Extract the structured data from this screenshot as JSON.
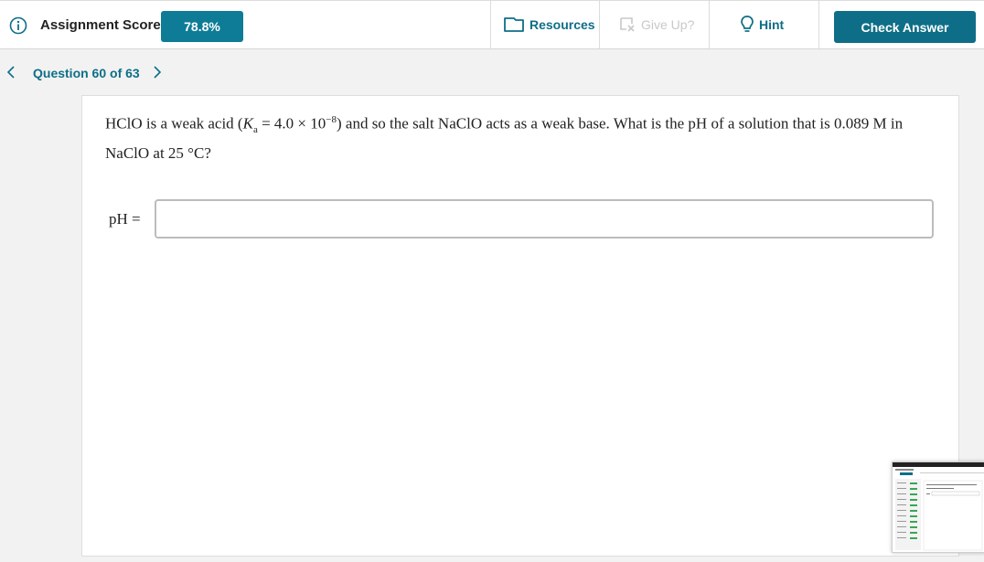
{
  "header": {
    "score_label": "Assignment Score:",
    "score_value": "78.8%",
    "resources_label": "Resources",
    "giveup_label": "Give Up?",
    "hint_label": "Hint",
    "check_answer_label": "Check Answer"
  },
  "nav": {
    "question_label": "Question 60 of 63"
  },
  "question": {
    "t1": "HClO is a weak acid (",
    "k": "K",
    "a": "a",
    "t2": " = 4.0 × 10",
    "exp": "−8",
    "t3": ") and so the salt NaClO acts as a weak base. What is the pH of a solution that is 0.089 M in NaClO at 25 °C?",
    "answer_label": "pH =",
    "answer_value": ""
  },
  "icons": {
    "info": "info-icon",
    "resources": "book-icon",
    "giveup": "give-up-icon",
    "hint": "lightbulb-icon",
    "prev": "chevron-left-icon",
    "next": "chevron-right-icon"
  },
  "colors": {
    "accent": "#0e6e87",
    "score_badge": "#0e7c96",
    "disabled": "#c8c8c8"
  }
}
